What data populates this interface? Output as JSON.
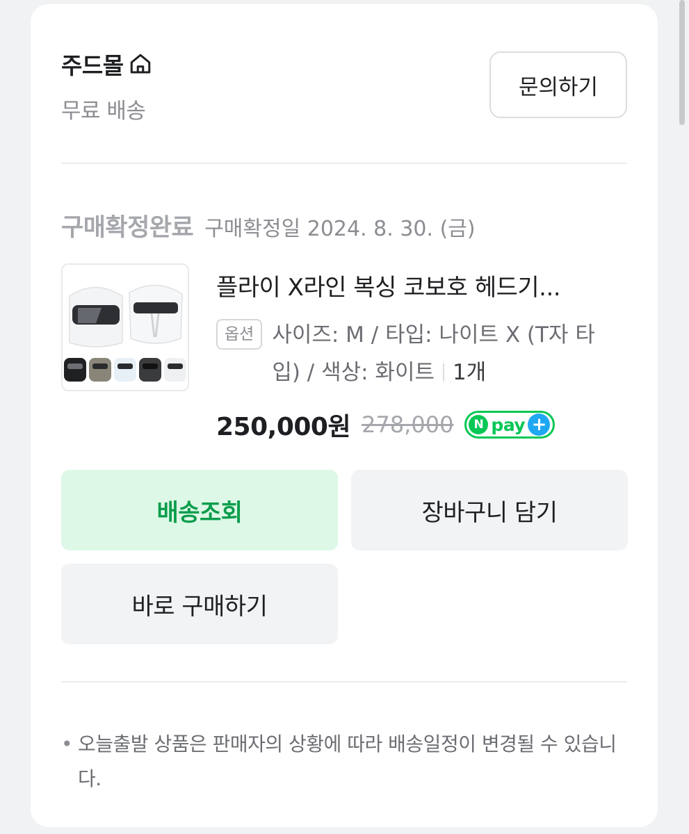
{
  "store": {
    "name": "주드몰",
    "shipping": "무료 배송",
    "inquiry_label": "문의하기"
  },
  "order": {
    "status": "구매확정완료",
    "confirm_date": "구매확정일 2024. 8. 30. (금)"
  },
  "product": {
    "name": "플라이 X라인 복싱 코보호 헤드기...",
    "option_badge": "옵션",
    "option_line1": "사이즈: M / 타입: 나이트 X (T자 타",
    "option_line2": "입) / 색상: 화이트",
    "quantity": "1개",
    "price": "250,000원",
    "original_price": "278,000",
    "npay": {
      "n": "N",
      "label": "pay",
      "plus": "+"
    }
  },
  "actions": {
    "track_delivery": "배송조회",
    "add_to_cart": "장바구니 담기",
    "buy_now": "바로 구매하기"
  },
  "notice": {
    "bullet": "•",
    "text": "오늘출발 상품은 판매자의 상황에 따라 배송일정이 변경될 수 있습니다."
  },
  "colors": {
    "accent_green": "#0b9d4c",
    "green_button_bg": "#ddf8e6",
    "npay_green": "#07c755",
    "npay_blue": "#1fa7f2"
  }
}
